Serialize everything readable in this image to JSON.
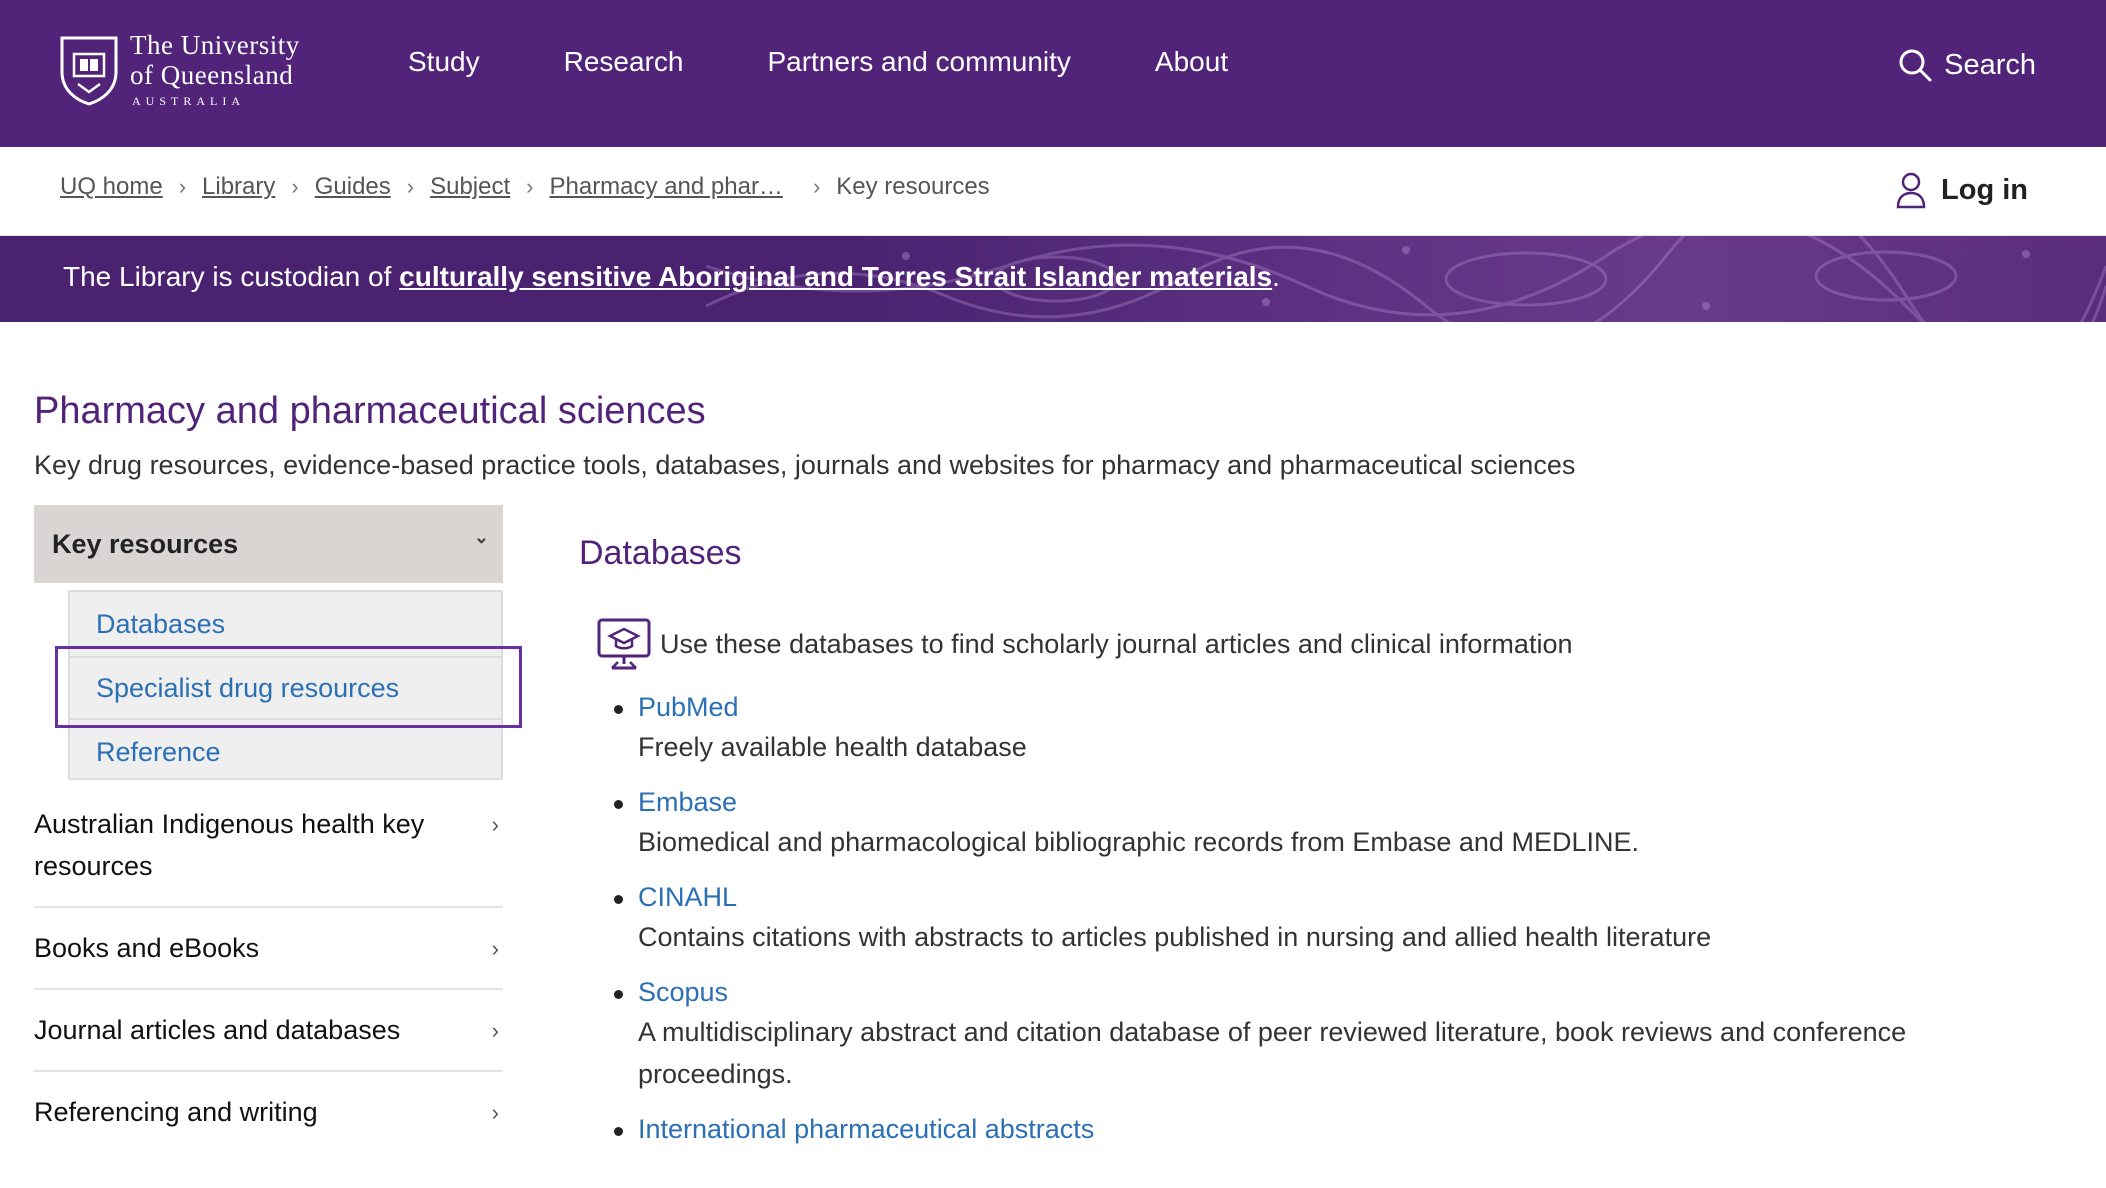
{
  "header": {
    "logo": {
      "line1": "The University",
      "line2": "of Queensland",
      "line3": "AUSTRALIA"
    },
    "nav": [
      "Study",
      "Research",
      "Partners and community",
      "About"
    ],
    "search_label": "Search"
  },
  "breadcrumb": {
    "items": [
      "UQ home",
      "Library",
      "Guides",
      "Subject",
      "Pharmacy and phar…"
    ],
    "current": "Key resources"
  },
  "login_label": "Log in",
  "banner": {
    "prefix": "The Library is custodian of ",
    "link": "culturally sensitive Aboriginal and Torres Strait Islander materials",
    "suffix": "."
  },
  "page": {
    "title": "Pharmacy and pharmaceutical sciences",
    "subtitle": "Key drug resources, evidence-based practice tools, databases, journals and websites for pharmacy and pharmaceutical sciences"
  },
  "sidebar": {
    "active_section": "Key resources",
    "subitems": [
      "Databases",
      "Specialist drug resources",
      "Reference"
    ],
    "items": [
      "Australian Indigenous health key resources",
      "Books and eBooks",
      "Journal articles and databases",
      "Referencing and writing"
    ]
  },
  "main": {
    "section_title": "Databases",
    "intro": "Use these databases to find scholarly journal articles and clinical information",
    "databases": [
      {
        "name": "PubMed",
        "desc": "Freely available health database"
      },
      {
        "name": "Embase",
        "desc": "Biomedical and pharmacological bibliographic records from Embase and MEDLINE."
      },
      {
        "name": "CINAHL",
        "desc": "Contains citations with abstracts to articles published in nursing and allied health literature"
      },
      {
        "name": "Scopus",
        "desc": "A multidisciplinary abstract and citation database of peer reviewed literature, book reviews and conference proceedings."
      },
      {
        "name": "International pharmaceutical abstracts",
        "desc": ""
      }
    ]
  },
  "colors": {
    "brand_purple": "#51247a",
    "link_blue": "#2b6fb5",
    "highlight": "#6a2fa0"
  }
}
